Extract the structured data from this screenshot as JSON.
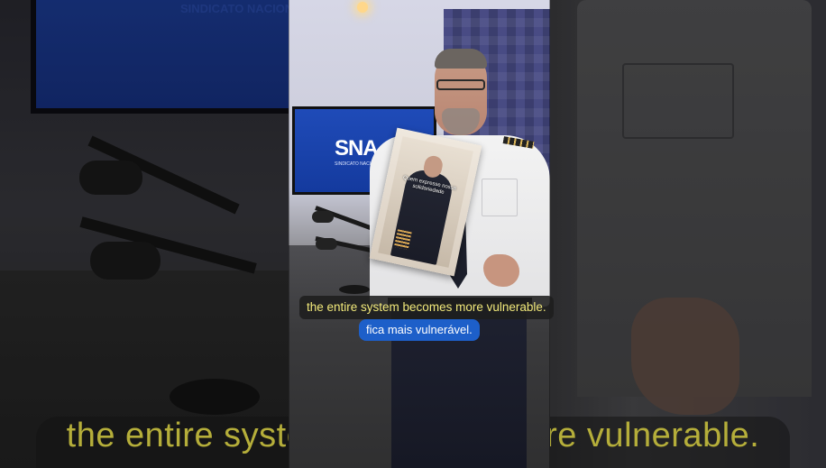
{
  "background": {
    "monitor_text": "SINDICATO NACIONAL DOS AERON",
    "caption_text": "the entire system becomes more vulnerable."
  },
  "video": {
    "logo": "SNA",
    "logo_subtitle": "SINDICATO NACIONAL DOS AERONAUTAS",
    "poster_text": "Quem expresse nossa solidariedade"
  },
  "captions": {
    "english": "the entire system becomes more vulnerable.",
    "portuguese": "fica mais vulnerável."
  },
  "colors": {
    "caption_en_text": "#f2e97a",
    "caption_pt_bg": "#1d5fc9",
    "monitor_blue": "#1f4bb8"
  }
}
